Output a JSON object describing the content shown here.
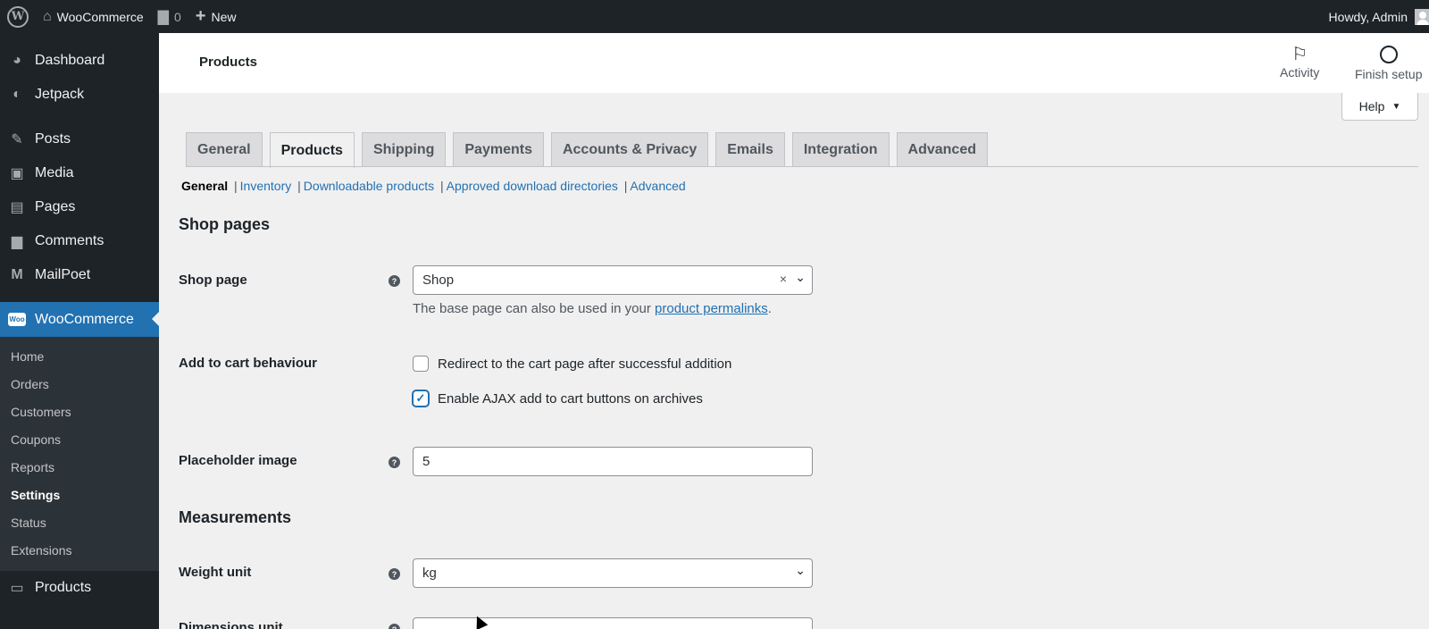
{
  "adminbar": {
    "site_name": "WooCommerce",
    "comments_count": "0",
    "new_label": "New",
    "howdy": "Howdy, Admin"
  },
  "sidebar": {
    "items_top": [
      {
        "label": "Dashboard",
        "icon": "dashboard-icon"
      },
      {
        "label": "Jetpack",
        "icon": "jetpack-icon"
      }
    ],
    "items_mid": [
      {
        "label": "Posts",
        "icon": "pin-icon"
      },
      {
        "label": "Media",
        "icon": "media-icon"
      },
      {
        "label": "Pages",
        "icon": "pages-icon"
      },
      {
        "label": "Comments",
        "icon": "comment-icon"
      },
      {
        "label": "MailPoet",
        "icon": "mailpoet-icon"
      }
    ],
    "woocommerce": {
      "label": "WooCommerce",
      "logo_text": "Woo"
    },
    "submenu": [
      "Home",
      "Orders",
      "Customers",
      "Coupons",
      "Reports",
      "Settings",
      "Status",
      "Extensions"
    ],
    "products": {
      "label": "Products"
    }
  },
  "header": {
    "title": "Products",
    "activity_label": "Activity",
    "finish_setup_label": "Finish setup",
    "help_label": "Help"
  },
  "tabs": [
    "General",
    "Products",
    "Shipping",
    "Payments",
    "Accounts & Privacy",
    "Emails",
    "Integration",
    "Advanced"
  ],
  "subnav": [
    "General",
    "Inventory",
    "Downloadable products",
    "Approved download directories",
    "Advanced"
  ],
  "shop_pages": {
    "heading": "Shop pages",
    "shop_page_label": "Shop page",
    "shop_page_value": "Shop",
    "shop_page_desc_prefix": "The base page can also be used in your ",
    "shop_page_desc_link": "product permalinks",
    "shop_page_desc_suffix": ".",
    "add_to_cart_label": "Add to cart behaviour",
    "redirect_label": "Redirect to the cart page after successful addition",
    "ajax_label": "Enable AJAX add to cart buttons on archives",
    "placeholder_label": "Placeholder image",
    "placeholder_value": "5"
  },
  "measurements": {
    "heading": "Measurements",
    "weight_label": "Weight unit",
    "weight_value": "kg",
    "dimensions_label": "Dimensions unit"
  }
}
